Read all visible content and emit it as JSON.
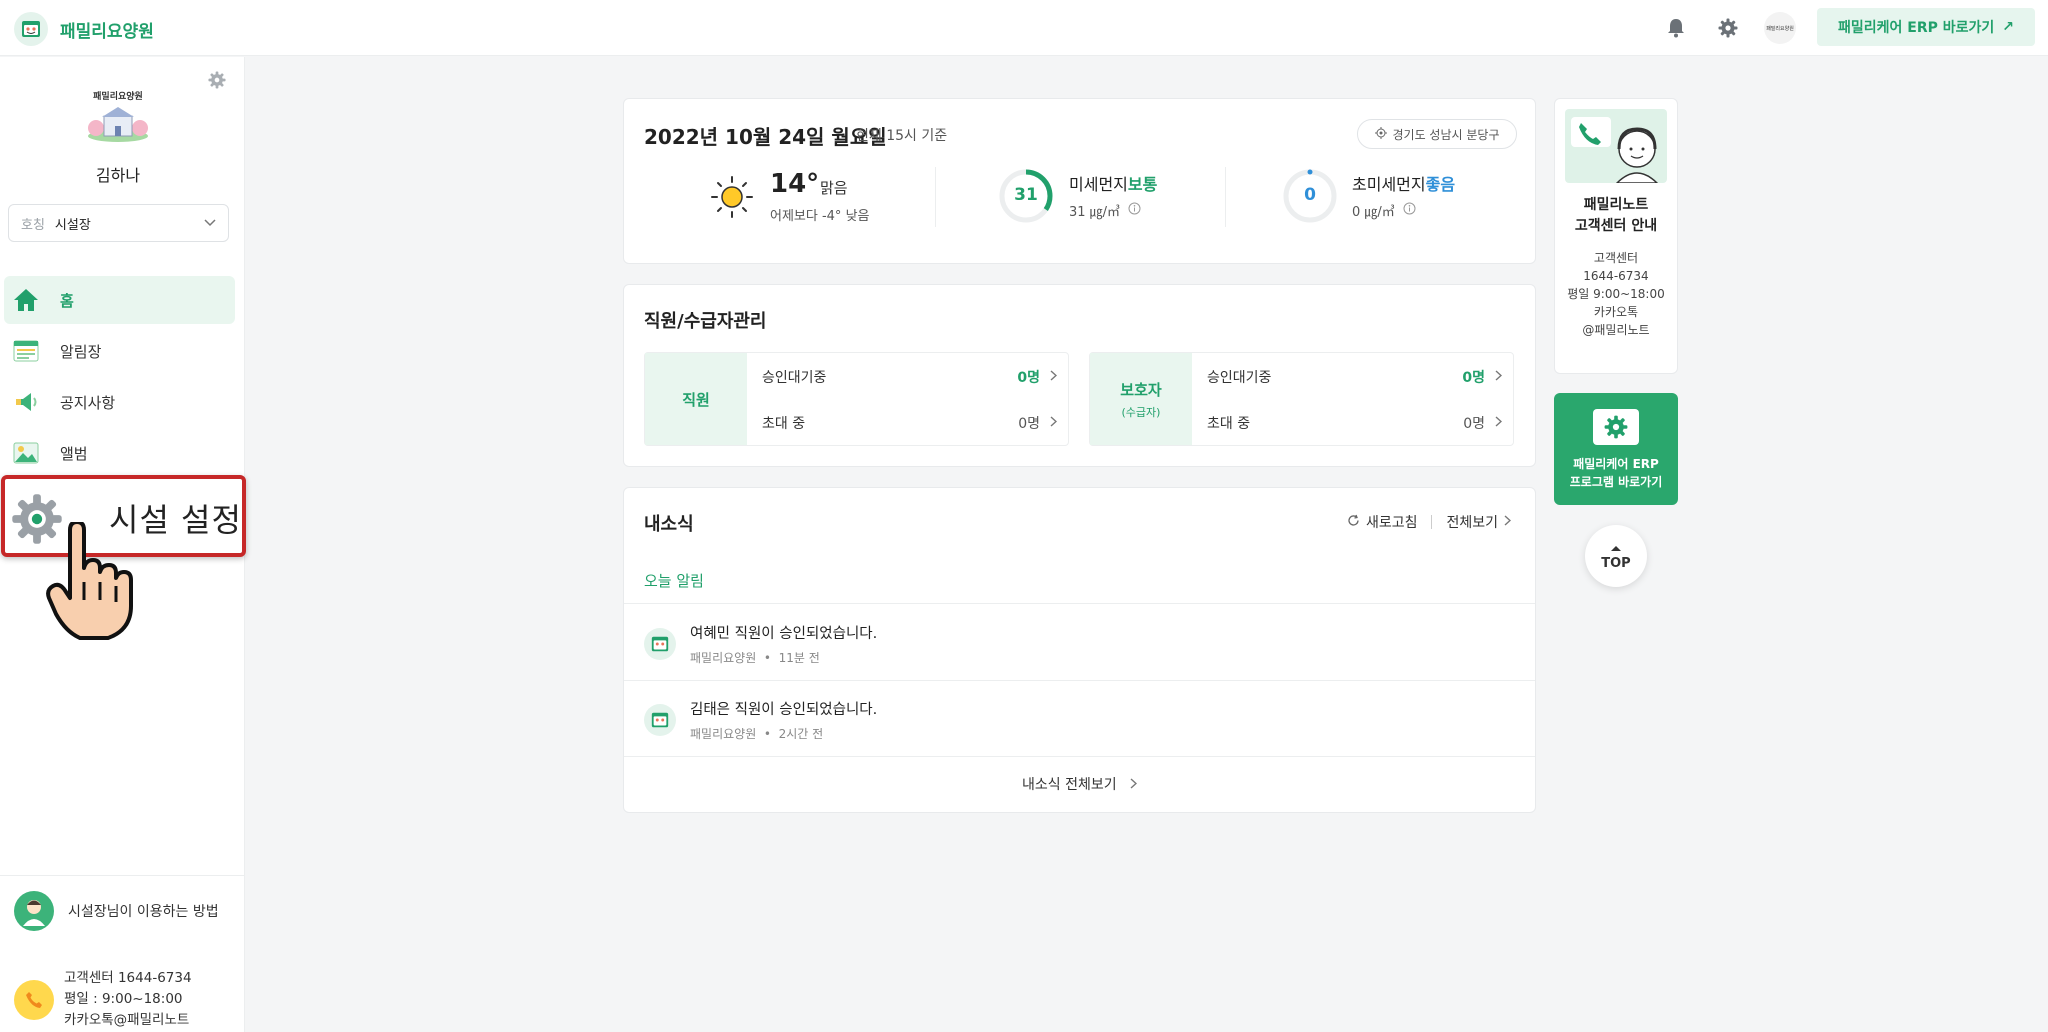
{
  "app": {
    "brand_name": "패밀리요양원",
    "erp_link_label": "패밀리케어 ERP 바로가기",
    "top_avatar_text": "패밀리요양원"
  },
  "sidebar": {
    "facility_logo_text": "패밀리요양원",
    "user_name": "김하나",
    "role_label": "호칭",
    "role_value": "시설장",
    "nav": [
      {
        "label": "홈",
        "icon": "home-icon",
        "active": true
      },
      {
        "label": "알림장",
        "icon": "notice-board-icon",
        "active": false
      },
      {
        "label": "공지사항",
        "icon": "megaphone-icon",
        "active": false
      },
      {
        "label": "앨범",
        "icon": "album-icon",
        "active": false
      }
    ],
    "howto_label": "시설장님이 이용하는 방법",
    "contact_lines": [
      "고객센터 1644-6734",
      "평일 : 9:00~18:00",
      "카카오톡@패밀리노트"
    ]
  },
  "overlay": {
    "highlight_label": "시설 설정"
  },
  "weather": {
    "date": "2022년 10월 24일 월요일",
    "basis": "현재 15시 기준",
    "location": "경기도 성남시 분당구",
    "temperature": "14°",
    "condition": "맑음",
    "comparison": "어제보다 -4° 낮음",
    "pm10": {
      "value": "31",
      "title": "미세먼지",
      "status": "보통",
      "unit": "31 ㎍/㎥",
      "color": "#21a06b"
    },
    "pm25": {
      "value": "0",
      "title": "초미세먼지",
      "status": "좋음",
      "unit": "0 ㎍/㎥",
      "color": "#2f8fd8"
    }
  },
  "staff": {
    "title": "직원/수급자관리",
    "boxes": [
      {
        "label": "직원",
        "sublabel": "",
        "rows": [
          {
            "label": "승인대기중",
            "value": "0명"
          },
          {
            "label": "초대 중",
            "value": "0명"
          }
        ]
      },
      {
        "label": "보호자",
        "sublabel": "(수급자)",
        "rows": [
          {
            "label": "승인대기중",
            "value": "0명"
          },
          {
            "label": "초대 중",
            "value": "0명"
          }
        ]
      }
    ]
  },
  "news": {
    "title": "내소식",
    "refresh_label": "새로고침",
    "view_all_label": "전체보기",
    "today_label": "오늘 알림",
    "items": [
      {
        "text": "여혜민 직원이 승인되었습니다.",
        "source": "패밀리요양원",
        "time": "11분 전"
      },
      {
        "text": "김태은 직원이 승인되었습니다.",
        "source": "패밀리요양원",
        "time": "2시간 전"
      }
    ],
    "all_news_label": "내소식 전체보기"
  },
  "right": {
    "cs_title_1": "패밀리노트",
    "cs_title_2": "고객센터 안내",
    "cs_lines": [
      "고객센터",
      "1644-6734",
      "평일 9:00~18:00",
      "카카오톡",
      "@패밀리노트"
    ],
    "erp_line_1": "패밀리케어 ERP",
    "erp_line_2": "프로그램 바로가기",
    "top_label": "TOP"
  },
  "colors": {
    "brand_green": "#21a06b",
    "highlight_border": "#c62828",
    "good_blue": "#2f8fd8"
  }
}
